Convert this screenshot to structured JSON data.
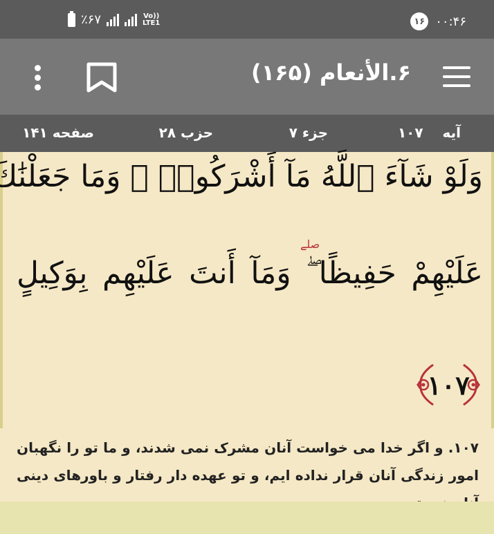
{
  "status_bar": {
    "time": "۰۰:۴۶",
    "notification_count": "۱۶",
    "battery_percent": "٪۶۷",
    "network": "LTE1",
    "volte": "Vo))"
  },
  "toolbar": {
    "title": "۶.الأنعام (۱۶۵)"
  },
  "info_bar": {
    "ayah_label": "آیه",
    "ayah_number": "۱۰۷",
    "juz": "جزء ۷",
    "hizb": "حزب ۲۸",
    "page": "صفحه ۱۴۱"
  },
  "quran": {
    "line1": "وَلَوْ شَآءَ ٱللَّهُ مَآ أَشْرَكُوا۟ ۗ وَمَا جَعَلْنَٰكَ",
    "line2": "عَلَيْهِمْ حَفِيظًا ۖ وَمَآ أَنتَ عَلَيْهِم بِوَكِيلٍ",
    "pause_mark": "صلے",
    "ayah_marker": "۱۰۷"
  },
  "translation": "۱۰۷. و اگر خدا می خواست آنان مشرک نمی شدند، و ما تو را نگهبان امور زندگی آنان قرار نداده ایم، و تو عهده دار رفتار و باورهای دینی آنان نیستی.",
  "colors": {
    "page_bg": "#f5e8c6",
    "status_bar": "#5b5b5b",
    "toolbar": "#787878",
    "ornament": "#b8323a"
  }
}
